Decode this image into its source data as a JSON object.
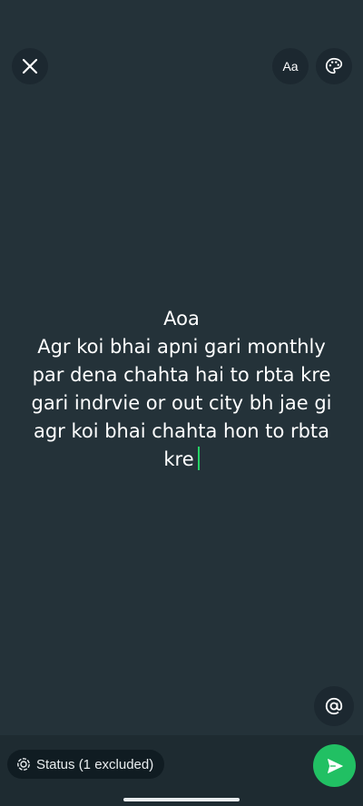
{
  "toolbar": {
    "close_icon": "close-icon",
    "font_label": "Aa",
    "palette_icon": "palette-icon"
  },
  "status_text": {
    "lines": [
      "Aoa",
      "Agr koi bhai apni gari monthly",
      "par dena chahta hai to rbta kre",
      "gari indrvie or out city bh jae gi",
      "agr koi bhai chahta hon to rbta",
      "kre"
    ]
  },
  "mention": {
    "icon": "at-sign-icon"
  },
  "bottom_bar": {
    "audience_label": "Status (1 excluded)",
    "audience_icon": "status-icon",
    "send_icon": "send-icon"
  },
  "colors": {
    "background": "#243239",
    "accent": "#21c063",
    "cursor": "#25d366"
  }
}
